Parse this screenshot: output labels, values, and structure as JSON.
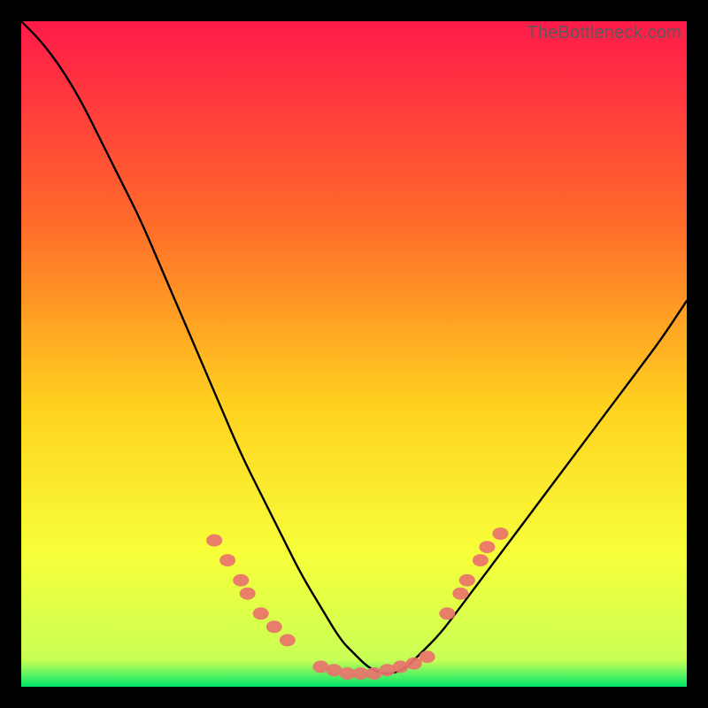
{
  "watermark": "TheBottleneck.com",
  "colors": {
    "background": "#000000",
    "gradient_top": "#ff1a4a",
    "gradient_mid1": "#ff6a2a",
    "gradient_mid2": "#ffd21f",
    "gradient_mid3": "#f7ff3a",
    "gradient_bottom": "#00e66b",
    "curve": "#000000",
    "markers": "#e9736c",
    "watermark": "#5a5a5a"
  },
  "chart_data": {
    "type": "line",
    "title": "",
    "xlabel": "",
    "ylabel": "",
    "xlim": [
      0,
      100
    ],
    "ylim": [
      0,
      100
    ],
    "series": [
      {
        "name": "bottleneck-curve",
        "x": [
          0,
          3,
          6,
          9,
          12,
          15,
          18,
          21,
          24,
          27,
          30,
          33,
          36,
          39,
          42,
          45,
          48,
          50,
          52,
          54,
          56,
          58,
          60,
          63,
          66,
          69,
          72,
          75,
          78,
          81,
          84,
          87,
          90,
          93,
          96,
          100
        ],
        "y": [
          100,
          97,
          93,
          88,
          82,
          76,
          70,
          63,
          56,
          49,
          42,
          35,
          29,
          23,
          17,
          12,
          7,
          5,
          3,
          2,
          2,
          3,
          5,
          8,
          12,
          16,
          20,
          24,
          28,
          32,
          36,
          40,
          44,
          48,
          52,
          58
        ]
      }
    ],
    "marker_clusters": [
      {
        "name": "left-cluster",
        "points": [
          {
            "x": 29,
            "y": 22
          },
          {
            "x": 31,
            "y": 19
          },
          {
            "x": 33,
            "y": 16
          },
          {
            "x": 34,
            "y": 14
          },
          {
            "x": 36,
            "y": 11
          },
          {
            "x": 38,
            "y": 9
          },
          {
            "x": 40,
            "y": 7
          }
        ]
      },
      {
        "name": "valley-cluster",
        "points": [
          {
            "x": 45,
            "y": 3
          },
          {
            "x": 47,
            "y": 2.5
          },
          {
            "x": 49,
            "y": 2
          },
          {
            "x": 51,
            "y": 2
          },
          {
            "x": 53,
            "y": 2
          },
          {
            "x": 55,
            "y": 2.5
          },
          {
            "x": 57,
            "y": 3
          },
          {
            "x": 59,
            "y": 3.5
          },
          {
            "x": 61,
            "y": 4.5
          }
        ]
      },
      {
        "name": "right-cluster",
        "points": [
          {
            "x": 64,
            "y": 11
          },
          {
            "x": 66,
            "y": 14
          },
          {
            "x": 67,
            "y": 16
          },
          {
            "x": 69,
            "y": 19
          },
          {
            "x": 70,
            "y": 21
          },
          {
            "x": 72,
            "y": 23
          }
        ]
      }
    ]
  }
}
